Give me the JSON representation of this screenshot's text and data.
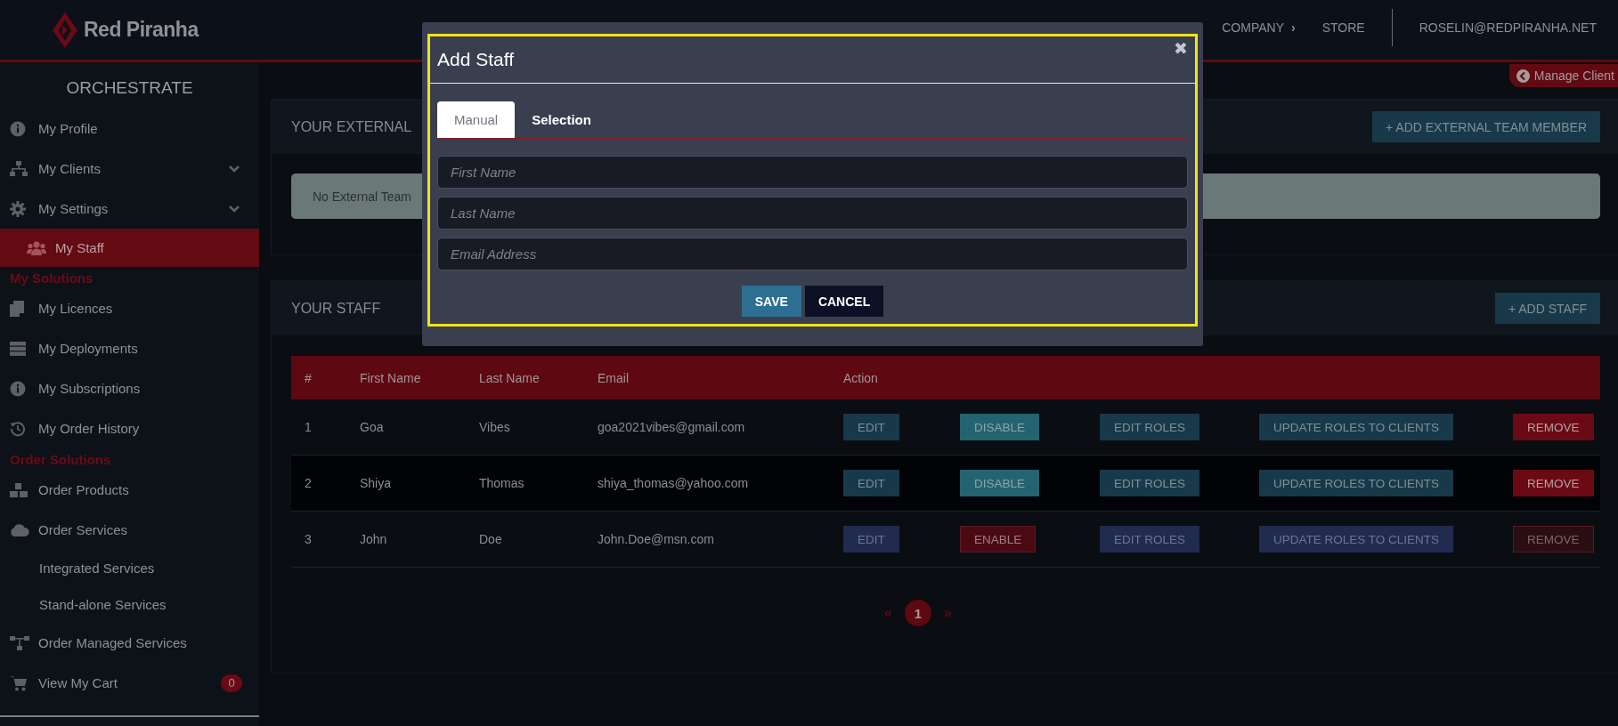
{
  "header": {
    "logo_text": "Red Piranha",
    "nav": [
      {
        "label": "COMPANY",
        "caret": "›"
      },
      {
        "label": "STORE"
      }
    ],
    "user": "ROSELIN@REDPIRANHA.NET"
  },
  "sidebar": {
    "title": "ORCHESTRATE",
    "items": [
      {
        "kind": "item",
        "label": "My Profile",
        "selected": false
      },
      {
        "kind": "item",
        "label": "My Clients",
        "selected": false,
        "expandable": true
      },
      {
        "kind": "item",
        "label": "My Settings",
        "selected": false,
        "expandable": true
      },
      {
        "kind": "subitem",
        "label": "My Staff",
        "selected": true
      },
      {
        "kind": "section",
        "label": "My Solutions"
      },
      {
        "kind": "item",
        "label": "My Licences",
        "selected": false
      },
      {
        "kind": "item",
        "label": "My Deployments",
        "selected": false
      },
      {
        "kind": "item",
        "label": "My Subscriptions",
        "selected": false
      },
      {
        "kind": "item",
        "label": "My Order History",
        "selected": false
      },
      {
        "kind": "section",
        "label": "Order Solutions"
      },
      {
        "kind": "item",
        "label": "Order Products",
        "selected": false
      },
      {
        "kind": "item",
        "label": "Order Services",
        "selected": false
      },
      {
        "kind": "subitem",
        "label": "Integrated Services",
        "selected": false
      },
      {
        "kind": "subitem",
        "label": "Stand-alone Services",
        "selected": false
      },
      {
        "kind": "item",
        "label": "Order Managed Services",
        "selected": false
      },
      {
        "kind": "item",
        "label": "View My Cart",
        "selected": false,
        "badge": "0"
      }
    ]
  },
  "manage_tab": "Manage Client",
  "external_panel": {
    "title": "YOUR EXTERNAL",
    "button": "+ ADD EXTERNAL TEAM MEMBER",
    "message": "No External Team"
  },
  "staff_panel": {
    "title": "YOUR STAFF",
    "button": "+ ADD STAFF",
    "table": {
      "columns": [
        "#",
        "First Name",
        "Last Name",
        "Email",
        "Action"
      ],
      "rows": [
        {
          "cells": [
            "1",
            "Goa",
            "Vibes",
            "goa2021vibes@gmail.com"
          ],
          "enabled": true,
          "hovered": false,
          "actions": [
            {
              "kind": "edit",
              "label": "EDIT"
            },
            {
              "kind": "toggle",
              "label": "DISABLE"
            },
            {
              "kind": "roles",
              "label": "EDIT ROLES"
            },
            {
              "kind": "update",
              "label": "UPDATE ROLES TO CLIENTS"
            },
            {
              "kind": "remove",
              "label": "REMOVE"
            }
          ]
        },
        {
          "cells": [
            "2",
            "Shiya",
            "Thomas",
            "shiya_thomas@yahoo.com"
          ],
          "enabled": true,
          "hovered": true,
          "actions": [
            {
              "kind": "edit",
              "label": "EDIT"
            },
            {
              "kind": "toggle",
              "label": "DISABLE"
            },
            {
              "kind": "roles",
              "label": "EDIT ROLES"
            },
            {
              "kind": "update",
              "label": "UPDATE ROLES TO CLIENTS"
            },
            {
              "kind": "remove",
              "label": "REMOVE"
            }
          ]
        },
        {
          "cells": [
            "3",
            "John",
            "Doe",
            "John.Doe@msn.com"
          ],
          "enabled": false,
          "hovered": false,
          "actions": [
            {
              "kind": "edit",
              "label": "EDIT"
            },
            {
              "kind": "toggle",
              "label": "ENABLE"
            },
            {
              "kind": "roles",
              "label": "EDIT ROLES"
            },
            {
              "kind": "update",
              "label": "UPDATE ROLES TO CLIENTS"
            },
            {
              "kind": "remove",
              "label": "REMOVE"
            }
          ]
        }
      ]
    },
    "pagination": [
      {
        "label": "«",
        "selected": false
      },
      {
        "label": "1",
        "selected": true
      },
      {
        "label": "»",
        "selected": false
      }
    ]
  },
  "modal": {
    "title": "Add Staff",
    "close": "✖",
    "tabs": [
      {
        "label": "Manual",
        "selected": true
      },
      {
        "label": "Selection",
        "selected": false
      }
    ],
    "fields": [
      {
        "placeholder": "First Name"
      },
      {
        "placeholder": "Last Name"
      },
      {
        "placeholder": "Email Address"
      }
    ],
    "buttons": [
      {
        "kind": "primary",
        "label": "SAVE"
      },
      {
        "kind": "secondary",
        "label": "CANCEL"
      }
    ]
  }
}
